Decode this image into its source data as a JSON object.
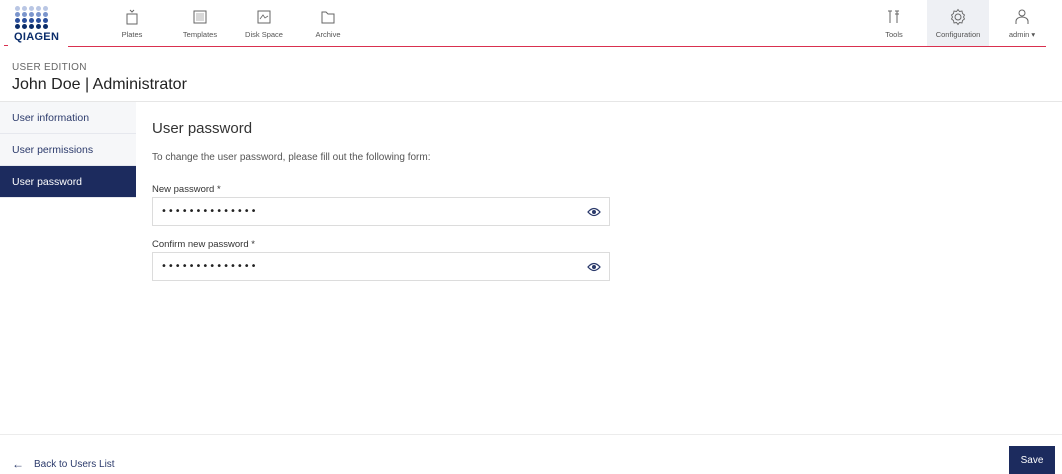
{
  "brand": {
    "logo_text": "QIAGEN",
    "accent_red": "#d9304f",
    "navy": "#1c2b5e",
    "logo_blue": "#0b2d6b"
  },
  "topnav": {
    "left": [
      {
        "label": "Plates",
        "icon": "plate-icon"
      },
      {
        "label": "Templates",
        "icon": "templates-icon"
      },
      {
        "label": "Disk Space",
        "icon": "disk-space-icon"
      },
      {
        "label": "Archive",
        "icon": "folder-icon"
      }
    ],
    "right": [
      {
        "label": "Tools",
        "icon": "tools-icon"
      },
      {
        "label": "Configuration",
        "icon": "gear-icon",
        "active": true
      },
      {
        "label": "admin ▾",
        "icon": "user-icon"
      }
    ]
  },
  "header": {
    "edition": "USER EDITION",
    "title": "John Doe | Administrator"
  },
  "sidebar": {
    "items": [
      {
        "label": "User information",
        "active": false
      },
      {
        "label": "User permissions",
        "active": false
      },
      {
        "label": "User password",
        "active": true
      }
    ]
  },
  "form": {
    "title": "User password",
    "intro": "To change the user password, please fill out the following form:",
    "new_password": {
      "label": "New password *",
      "value": "••••••••••••••"
    },
    "confirm_password": {
      "label": "Confirm new password *",
      "value": "••••••••••••••"
    }
  },
  "footer": {
    "back_label": "Back to Users List",
    "save_label": "Save"
  }
}
